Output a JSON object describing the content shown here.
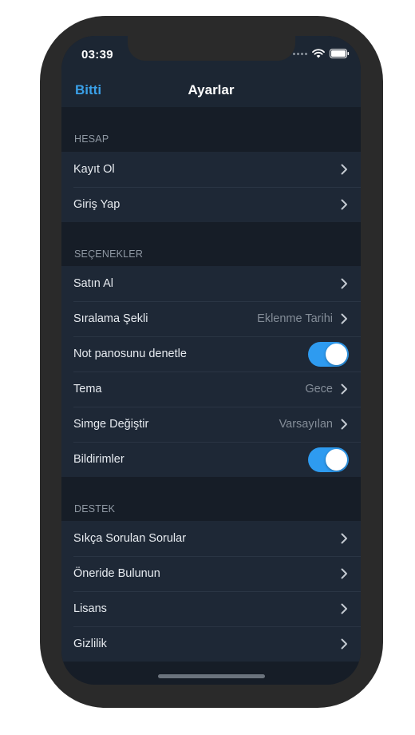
{
  "status_bar": {
    "time": "03:39",
    "icons": [
      "signal-dots-icon",
      "wifi-icon",
      "battery-icon"
    ]
  },
  "nav": {
    "left_button": "Bitti",
    "title": "Ayarlar"
  },
  "colors": {
    "accent": "#3aa0e8",
    "toggle_on": "#2e9bf0",
    "background": "#161d27",
    "cell_background": "#1e2836"
  },
  "sections": [
    {
      "header": "HESAP",
      "rows": [
        {
          "label": "Kayıt Ol",
          "accessory": "chevron-right-icon"
        },
        {
          "label": "Giriş Yap",
          "accessory": "chevron-right-icon"
        }
      ]
    },
    {
      "header": "SEÇENEKLER",
      "rows": [
        {
          "label": "Satın Al",
          "accessory": "chevron-right-icon"
        },
        {
          "label": "Sıralama Şekli",
          "value": "Eklenme Tarihi",
          "accessory": "chevron-right-icon"
        },
        {
          "label": "Not panosunu denetle",
          "toggle": true
        },
        {
          "label": "Tema",
          "value": "Gece",
          "accessory": "chevron-right-icon"
        },
        {
          "label": "Simge Değiştir",
          "value": "Varsayılan",
          "accessory": "chevron-right-icon"
        },
        {
          "label": "Bildirimler",
          "toggle": true
        }
      ]
    },
    {
      "header": "DESTEK",
      "rows": [
        {
          "label": "Sıkça Sorulan Sorular",
          "accessory": "chevron-right-icon"
        },
        {
          "label": "Öneride Bulunun",
          "accessory": "chevron-right-icon"
        },
        {
          "label": "Lisans",
          "accessory": "chevron-right-icon"
        },
        {
          "label": "Gizlilik",
          "accessory": "chevron-right-icon"
        }
      ]
    }
  ]
}
